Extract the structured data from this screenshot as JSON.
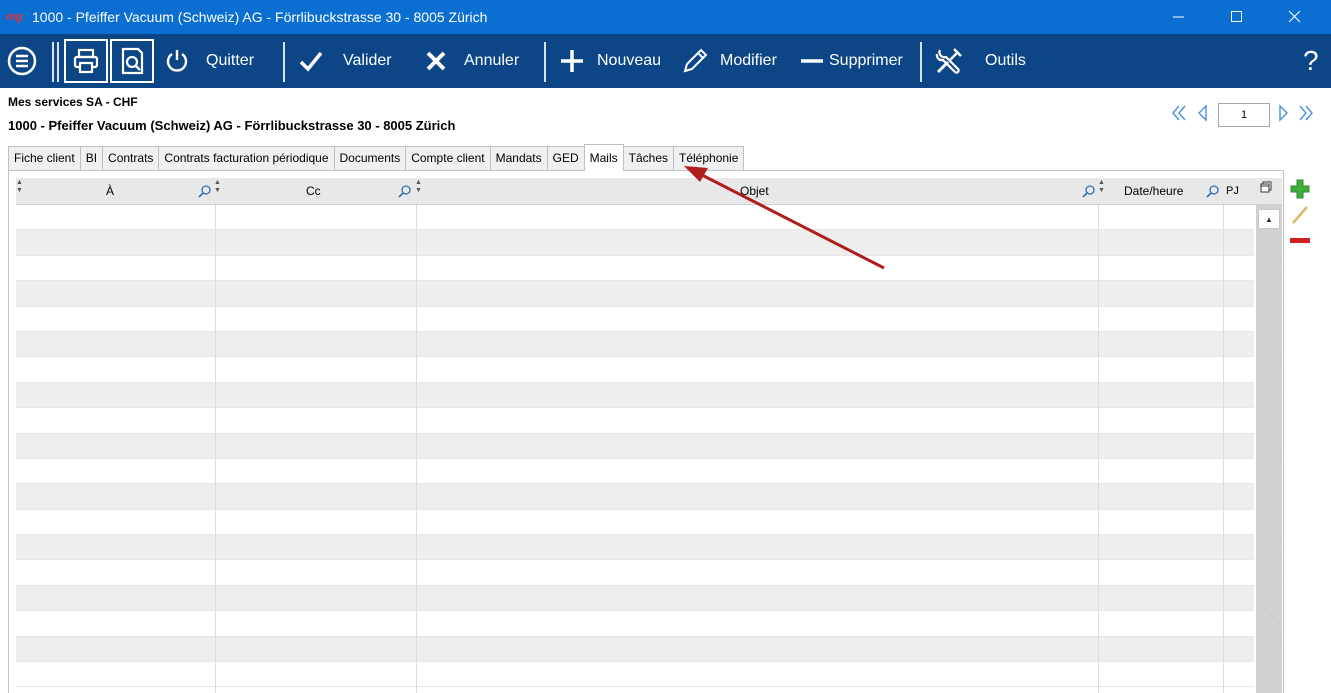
{
  "window": {
    "app_logo": "mg",
    "title": "1000 - Pfeiffer Vacuum (Schweiz) AG - Förrlibuckstrasse 30 - 8005 Zürich"
  },
  "toolbar": {
    "quit_label": "Quitter",
    "validate_label": "Valider",
    "cancel_label": "Annuler",
    "new_label": "Nouveau",
    "edit_label": "Modifier",
    "delete_label": "Supprimer",
    "tools_label": "Outils",
    "help_label": "?"
  },
  "header": {
    "company": "Mes services SA  -  CHF",
    "client": "1000 - Pfeiffer Vacuum (Schweiz) AG - Förrlibuckstrasse 30 - 8005 Zürich"
  },
  "pager": {
    "page": "1"
  },
  "tabs": [
    {
      "label": "Fiche client"
    },
    {
      "label": "BI"
    },
    {
      "label": "Contrats"
    },
    {
      "label": "Contrats facturation périodique"
    },
    {
      "label": "Documents"
    },
    {
      "label": "Compte client"
    },
    {
      "label": "Mandats"
    },
    {
      "label": "GED"
    },
    {
      "label": "Mails",
      "active": true
    },
    {
      "label": "Tâches"
    },
    {
      "label": "Téléphonie"
    }
  ],
  "grid": {
    "columns": {
      "to": "À",
      "cc": "Cc",
      "subject": "Objet",
      "datetime": "Date/heure",
      "attachments": "PJ"
    },
    "row_count": 19
  },
  "colors": {
    "titlebar": "#0a6fd0",
    "toolbar": "#0d4686",
    "arrow": "#b01d1d",
    "add": "#3fae3f",
    "delete": "#d02020",
    "edit": "#d9b96a"
  }
}
